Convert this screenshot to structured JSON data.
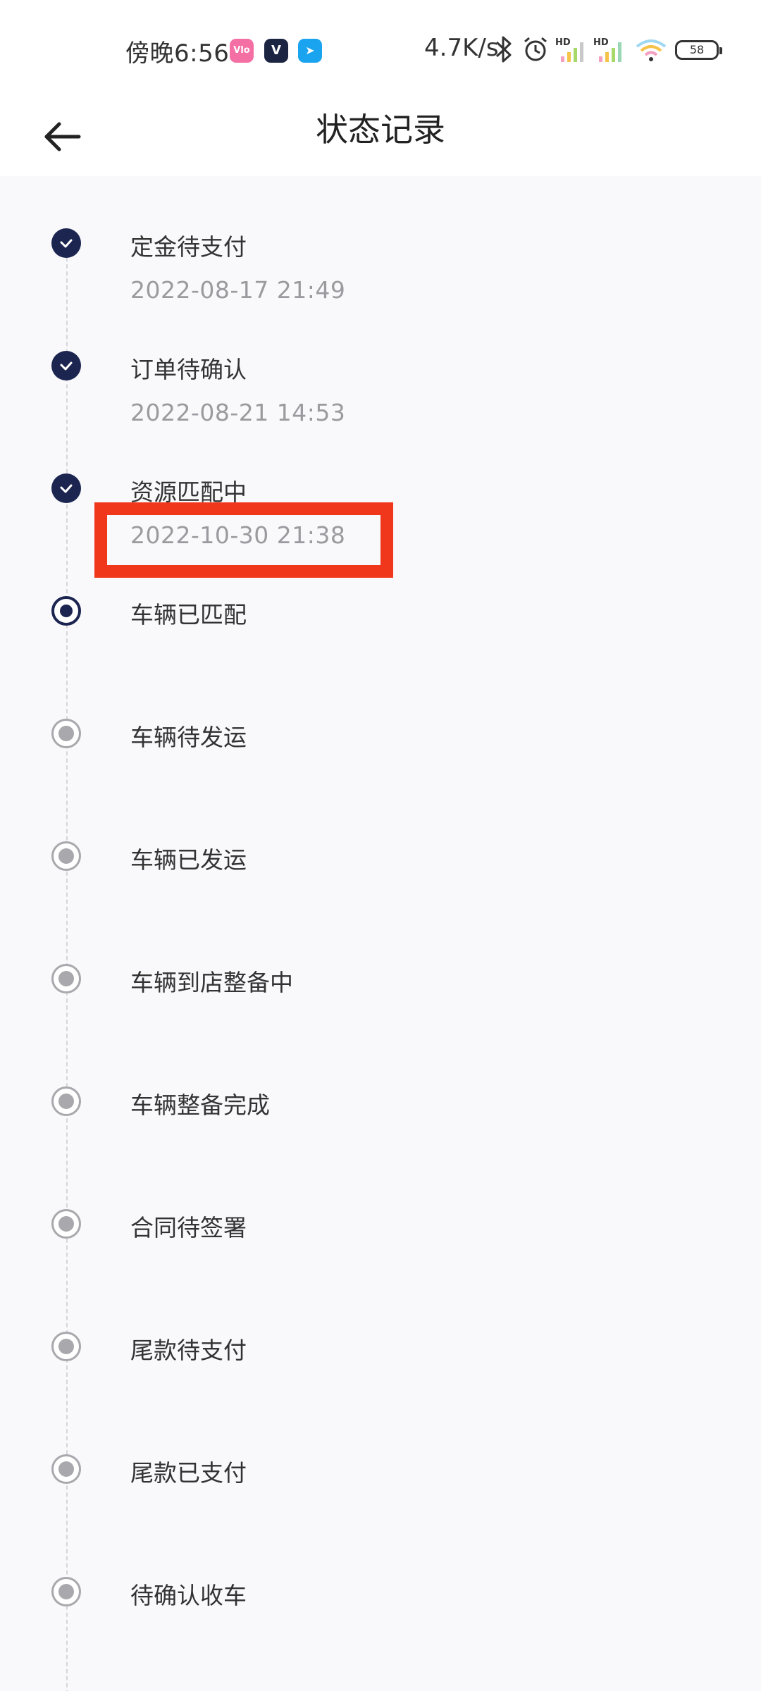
{
  "status_bar": {
    "time": "傍晚6:56",
    "app_icons": [
      {
        "name": "vivo-app-icon",
        "glyph": "Vlo",
        "color": "#f46fa3"
      },
      {
        "name": "v-app-icon",
        "glyph": "V",
        "color": "#1b2440"
      },
      {
        "name": "bird-app-icon",
        "glyph": "➤",
        "color": "#1aa3ee"
      }
    ],
    "network_speed": "4.7K/s",
    "battery": "58"
  },
  "header": {
    "title": "状态记录"
  },
  "timeline": {
    "items": [
      {
        "label": "定金待支付",
        "time": "2022-08-17 21:49",
        "state": "done"
      },
      {
        "label": "订单待确认",
        "time": "2022-08-21 14:53",
        "state": "done"
      },
      {
        "label": "资源匹配中",
        "time": "2022-10-30 21:38",
        "state": "done"
      },
      {
        "label": "车辆已匹配",
        "time": "",
        "state": "current"
      },
      {
        "label": "车辆待发运",
        "time": "",
        "state": "pending"
      },
      {
        "label": "车辆已发运",
        "time": "",
        "state": "pending"
      },
      {
        "label": "车辆到店整备中",
        "time": "",
        "state": "pending"
      },
      {
        "label": "车辆整备完成",
        "time": "",
        "state": "pending"
      },
      {
        "label": "合同待签署",
        "time": "",
        "state": "pending"
      },
      {
        "label": "尾款待支付",
        "time": "",
        "state": "pending"
      },
      {
        "label": "尾款已支付",
        "time": "",
        "state": "pending"
      },
      {
        "label": "待确认收车",
        "time": "",
        "state": "pending"
      }
    ]
  },
  "colors": {
    "accent": "#1c2550",
    "pending": "#a8a8ad",
    "highlight": "#f0371b",
    "background": "#f9f9fc"
  }
}
